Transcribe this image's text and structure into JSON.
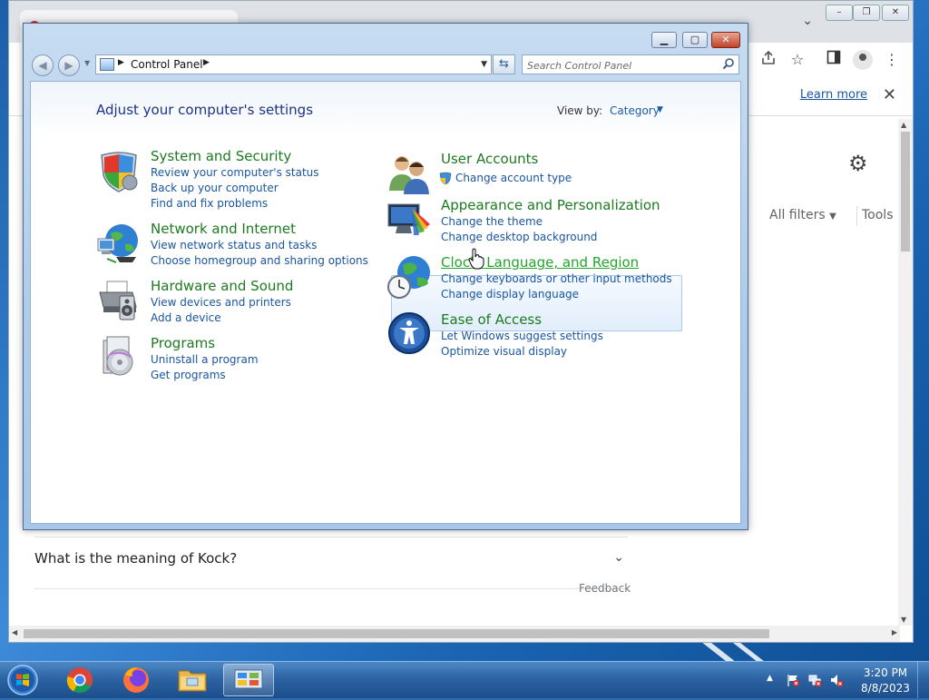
{
  "chrome": {
    "learn_more": "Learn more",
    "all_filters": "All filters",
    "tools": "Tools",
    "faq_question": "What is the meaning of Kock?",
    "feedback": "Feedback"
  },
  "control_panel": {
    "address_location": "Control Panel",
    "search_placeholder": "Search Control Panel",
    "heading": "Adjust your computer's settings",
    "view_by_label": "View by:",
    "view_by_value": "Category",
    "left_categories": [
      {
        "title": "System and Security",
        "icon": "shield-icon",
        "links": [
          "Review your computer's status",
          "Back up your computer",
          "Find and fix problems"
        ]
      },
      {
        "title": "Network and Internet",
        "icon": "globe-network-icon",
        "links": [
          "View network status and tasks",
          "Choose homegroup and sharing options"
        ]
      },
      {
        "title": "Hardware and Sound",
        "icon": "printer-icon",
        "links": [
          "View devices and printers",
          "Add a device"
        ]
      },
      {
        "title": "Programs",
        "icon": "programs-icon",
        "links": [
          "Uninstall a program",
          "Get programs"
        ]
      }
    ],
    "right_categories": [
      {
        "title": "User Accounts",
        "icon": "users-icon",
        "links": [
          "Change account type"
        ]
      },
      {
        "title": "Appearance and Personalization",
        "icon": "monitor-icon",
        "links": [
          "Change the theme",
          "Change desktop background"
        ]
      },
      {
        "title": "Clock, Language, and Region",
        "icon": "clock-globe-icon",
        "links": [
          "Change keyboards or other input methods",
          "Change display language"
        ]
      },
      {
        "title": "Ease of Access",
        "icon": "ease-of-access-icon",
        "links": [
          "Let Windows suggest settings",
          "Optimize visual display"
        ]
      }
    ]
  },
  "taskbar": {
    "apps": [
      "chrome-icon",
      "firefox-icon",
      "file-explorer-icon",
      "control-panel-icon"
    ],
    "time": "3:20 PM",
    "date": "8/8/2023"
  },
  "colors": {
    "category_title": "#1d7a20",
    "category_title_hover": "#22a52a",
    "link": "#1a56a0",
    "heading": "#1e3287"
  }
}
